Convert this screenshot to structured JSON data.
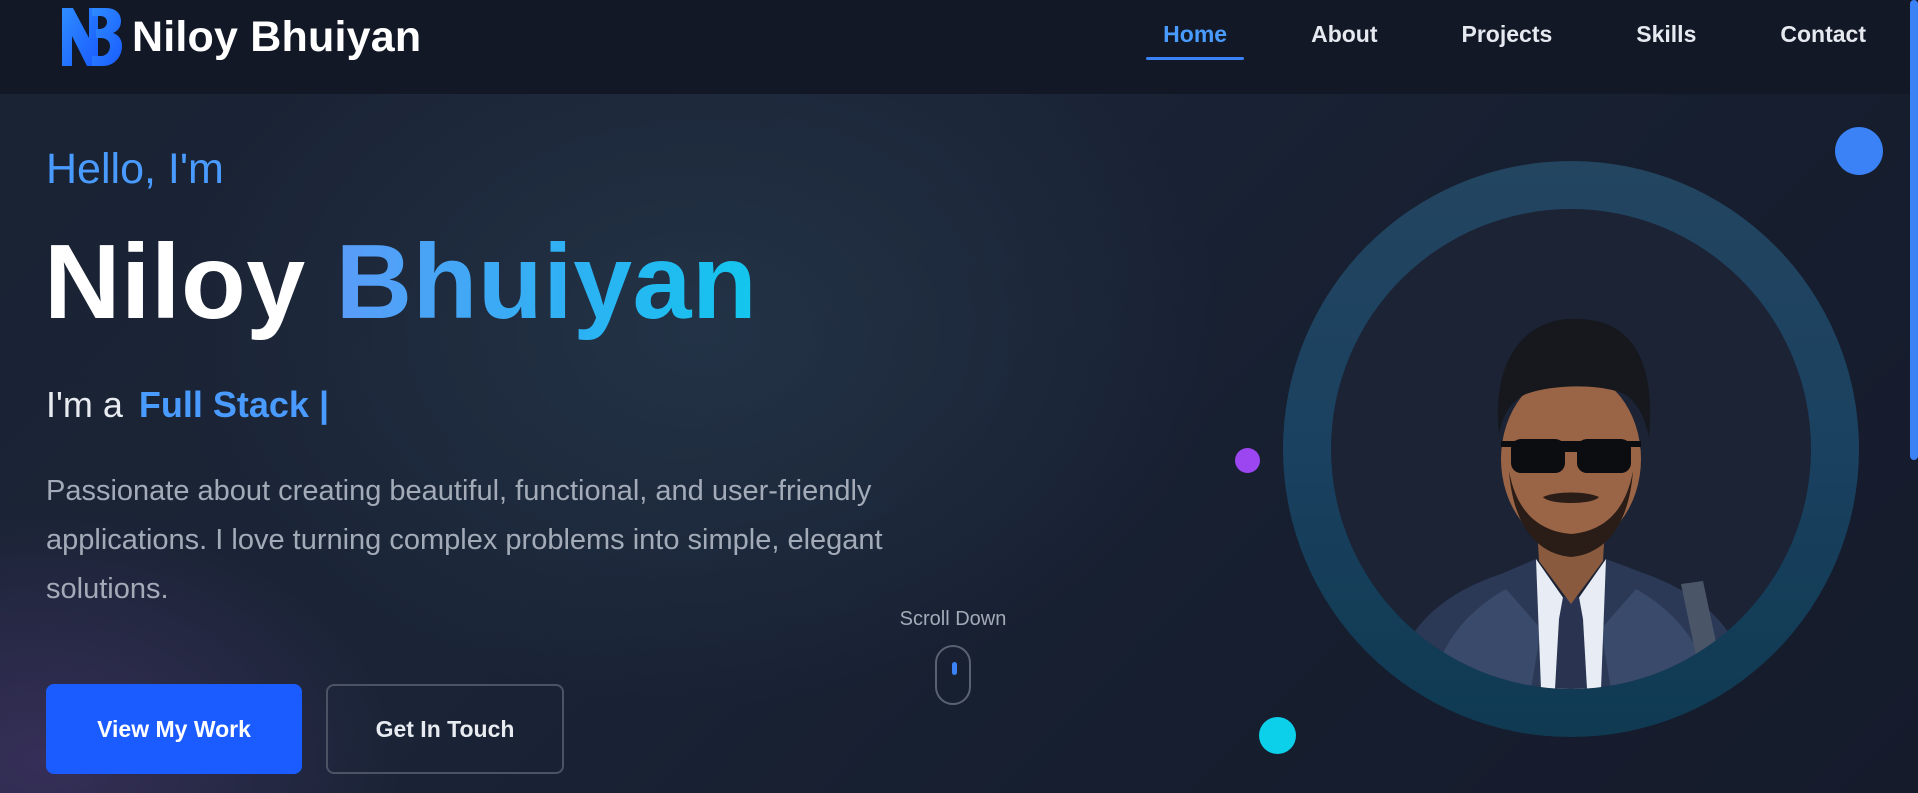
{
  "brand": {
    "name": "Niloy Bhuiyan",
    "logo_icon": "nb-monogram-icon"
  },
  "nav": {
    "items": [
      {
        "label": "Home",
        "active": true
      },
      {
        "label": "About",
        "active": false
      },
      {
        "label": "Projects",
        "active": false
      },
      {
        "label": "Skills",
        "active": false
      },
      {
        "label": "Contact",
        "active": false
      }
    ]
  },
  "hero": {
    "greeting": "Hello, I'm",
    "first_name": "Niloy",
    "last_name": "Bhuiyan",
    "role_prefix": "I'm a",
    "role": "Full Stack",
    "cursor": "|",
    "description": "Passionate about creating beautiful, functional, and user-friendly applications. I love turning complex problems into simple, elegant solutions.",
    "primary_button": "View My Work",
    "secondary_button": "Get In Touch",
    "scroll_label": "Scroll Down"
  },
  "colors": {
    "accent": "#3b82f6",
    "accent_text": "#4a9bff",
    "primary_button": "#1a5cff",
    "background": "#131a2a",
    "dot_purple": "#9b46f0",
    "dot_cyan": "#0ccfea"
  }
}
